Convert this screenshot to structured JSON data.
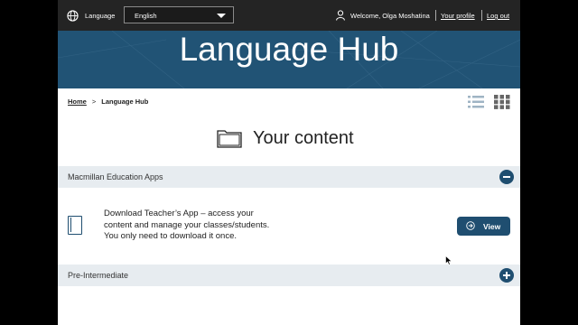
{
  "topbar": {
    "language_label": "Language",
    "language_selected": "English",
    "welcome": "Welcome, Olga Moshatina",
    "profile_link": "Your profile",
    "logout_link": "Log out"
  },
  "hero": {
    "title": "Language Hub"
  },
  "breadcrumb": {
    "home": "Home",
    "separator": ">",
    "current": "Language Hub"
  },
  "content": {
    "title": "Your content"
  },
  "sections": [
    {
      "label": "Macmillan Education Apps",
      "state": "expanded",
      "item": {
        "lines": [
          "Download Teacher’s App – access your",
          "content and manage your classes/students.",
          "You only need to download it once."
        ],
        "button_label": "View"
      }
    },
    {
      "label": "Pre-Intermediate",
      "state": "collapsed"
    }
  ],
  "colors": {
    "topbar": "#242424",
    "hero": "#215375",
    "accent": "#1f4e70",
    "section_header": "#e7ecf0"
  }
}
